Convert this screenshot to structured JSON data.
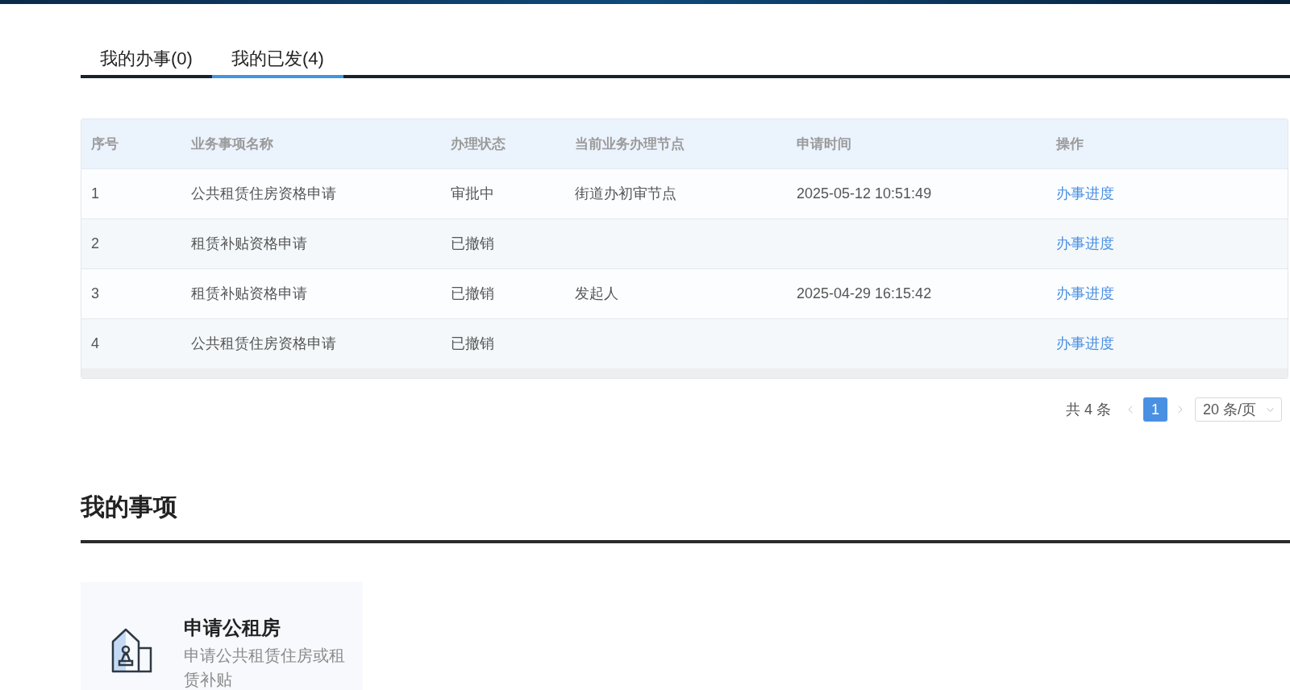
{
  "tabs": [
    {
      "label": "我的办事(0)",
      "selected": false
    },
    {
      "label": "我的已发(4)",
      "selected": true
    }
  ],
  "table": {
    "columns": [
      "序号",
      "业务事项名称",
      "办理状态",
      "当前业务办理节点",
      "申请时间",
      "操作"
    ],
    "rows": [
      {
        "index": "1",
        "name": "公共租赁住房资格申请",
        "status": "审批中",
        "node": "街道办初审节点",
        "time": "2025-05-12 10:51:49",
        "action": "办事进度"
      },
      {
        "index": "2",
        "name": "租赁补贴资格申请",
        "status": "已撤销",
        "action": "办事进度"
      },
      {
        "index": "3",
        "name": "租赁补贴资格申请",
        "status": "已撤销",
        "node": "发起人",
        "time": "2025-04-29 16:15:42",
        "action": "办事进度"
      },
      {
        "index": "4",
        "name": "公共租赁住房资格申请",
        "status": "已撤销",
        "action": "办事进度"
      }
    ]
  },
  "pagination": {
    "total": "共 4 条",
    "prev": {
      "disabled": true
    },
    "pages": [
      {
        "label": "1",
        "selected": true
      }
    ],
    "next": {
      "disabled": true
    },
    "page_size": "20 条/页"
  },
  "section": {
    "title": "我的事项"
  },
  "cards": [
    {
      "title": "申请公租房",
      "description": "申请公共租赁住房或租赁补贴"
    }
  ]
}
